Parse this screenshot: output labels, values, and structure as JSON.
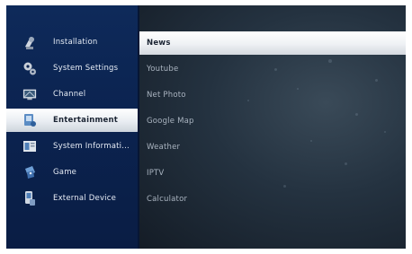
{
  "menu": {
    "items": [
      {
        "label": "Installation",
        "icon": "satellite-dish-icon"
      },
      {
        "label": "System Settings",
        "icon": "gears-icon"
      },
      {
        "label": "Channel",
        "icon": "tv-screen-icon"
      },
      {
        "label": "Entertainment",
        "icon": "entertainment-icon"
      },
      {
        "label": "System Informati...",
        "icon": "info-screen-icon"
      },
      {
        "label": "Game",
        "icon": "game-icon"
      },
      {
        "label": "External Device",
        "icon": "external-device-icon"
      }
    ],
    "active_index": 3
  },
  "submenu": {
    "items": [
      {
        "label": "News"
      },
      {
        "label": "Youtube"
      },
      {
        "label": "Net Photo"
      },
      {
        "label": "Google Map"
      },
      {
        "label": "Weather"
      },
      {
        "label": "IPTV"
      },
      {
        "label": "Calculator"
      }
    ],
    "active_index": 0
  },
  "colors": {
    "panel_blue": "#0b2350",
    "highlight": "#ffffff"
  }
}
